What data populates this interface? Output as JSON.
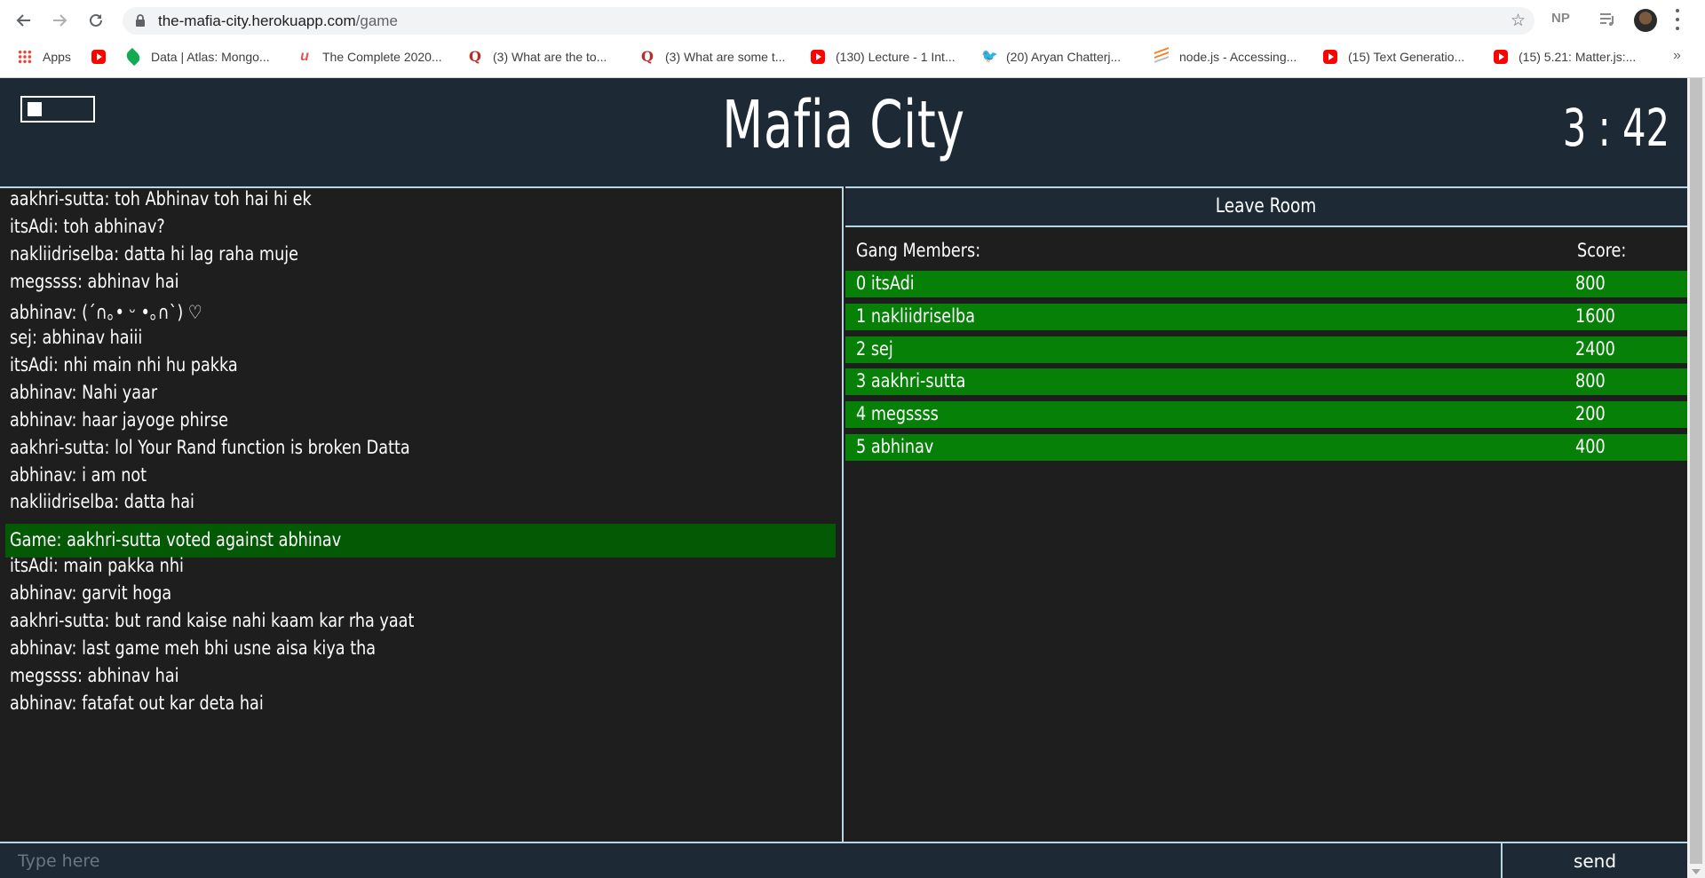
{
  "browser": {
    "url_host": "the-mafia-city.herokuapp.com",
    "url_path": "/game",
    "profile_badge": "NP",
    "bookmarks": [
      {
        "label": "Apps",
        "icon": "apps-icon"
      },
      {
        "label": "",
        "icon": "youtube-icon"
      },
      {
        "label": "Data | Atlas: Mongo...",
        "icon": "mongodb-leaf-icon"
      },
      {
        "label": "The Complete 2020...",
        "icon": "udemy-icon"
      },
      {
        "label": "(3) What are the to...",
        "icon": "quora-icon"
      },
      {
        "label": "(3) What are some t...",
        "icon": "quora-icon"
      },
      {
        "label": "(130) Lecture - 1 Int...",
        "icon": "youtube-icon"
      },
      {
        "label": "(20) Aryan Chatterj...",
        "icon": "twitter-icon"
      },
      {
        "label": "node.js - Accessing...",
        "icon": "stackoverflow-icon"
      },
      {
        "label": "(15) Text Generatio...",
        "icon": "youtube-icon"
      },
      {
        "label": "(15) 5.21: Matter.js:...",
        "icon": "youtube-icon"
      }
    ],
    "more_bookmarks": "»"
  },
  "header": {
    "title": "Mafia City",
    "timer": "3 : 42"
  },
  "chat": {
    "messages": [
      {
        "type": "user",
        "text": "aakhri-sutta: toh Abhinav toh hai hi ek"
      },
      {
        "type": "user",
        "text": "itsAdi: toh abhinav?"
      },
      {
        "type": "user",
        "text": "nakliidriselba: datta hi lag raha muje"
      },
      {
        "type": "user",
        "text": "megssss: abhinav hai"
      },
      {
        "type": "user",
        "text": "abhinav: (´∩｡• ᵕ •｡∩`) ♡"
      },
      {
        "type": "user",
        "text": "sej: abhinav haiii"
      },
      {
        "type": "user",
        "text": "itsAdi: nhi main nhi hu pakka"
      },
      {
        "type": "user",
        "text": "abhinav: Nahi yaar"
      },
      {
        "type": "user",
        "text": "abhinav: haar jayoge phirse"
      },
      {
        "type": "user",
        "text": "aakhri-sutta: lol Your Rand function is broken Datta"
      },
      {
        "type": "user",
        "text": "abhinav: i am not"
      },
      {
        "type": "user",
        "text": "nakliidriselba: datta hai"
      },
      {
        "type": "game",
        "text": "Game: aakhri-sutta voted against abhinav"
      },
      {
        "type": "user",
        "text": "itsAdi: main pakka nhi"
      },
      {
        "type": "user",
        "text": "abhinav: garvit hoga"
      },
      {
        "type": "user",
        "text": "aakhri-sutta: but rand kaise nahi kaam kar rha yaat"
      },
      {
        "type": "user",
        "text": "abhinav: last game meh bhi usne aisa kiya tha"
      },
      {
        "type": "user",
        "text": "megssss: abhinav hai"
      },
      {
        "type": "user",
        "text": "abhinav: fatafat out kar deta hai"
      }
    ]
  },
  "room": {
    "leave_label": "Leave Room",
    "members_heading": "Gang Members:",
    "score_heading": "Score:",
    "members": [
      {
        "name": "0 itsAdi",
        "score": "800"
      },
      {
        "name": "1 nakliidriselba",
        "score": "1600"
      },
      {
        "name": "2 sej",
        "score": "2400"
      },
      {
        "name": "3 aakhri-sutta",
        "score": "800"
      },
      {
        "name": "4 megssss",
        "score": "200"
      },
      {
        "name": "5 abhinav",
        "score": "400"
      }
    ]
  },
  "input": {
    "placeholder": "Type here",
    "send_label": "send"
  },
  "colors": {
    "header_bg": "#1d2a36",
    "panel_bg": "#1e1e1e",
    "member_row": "#078007",
    "game_message": "#045a04",
    "border": "#b7d6e3"
  }
}
